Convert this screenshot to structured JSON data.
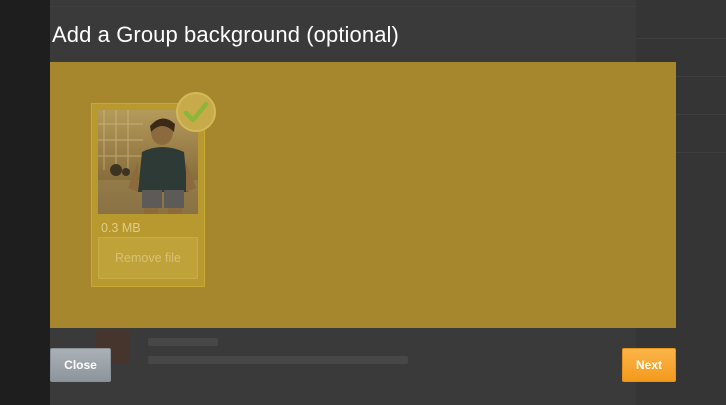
{
  "modal": {
    "title": "Add a Group background (optional)"
  },
  "file": {
    "size": "0.3 MB",
    "remove_label": "Remove file",
    "upload_complete": true,
    "thumbnail": "person-photo"
  },
  "footer": {
    "close_label": "Close",
    "next_label": "Next"
  },
  "colors": {
    "dropzone": "#a6872d",
    "next_button": "#f7a52a",
    "close_button": "#9aa1a8",
    "check": "#8cb63a"
  }
}
